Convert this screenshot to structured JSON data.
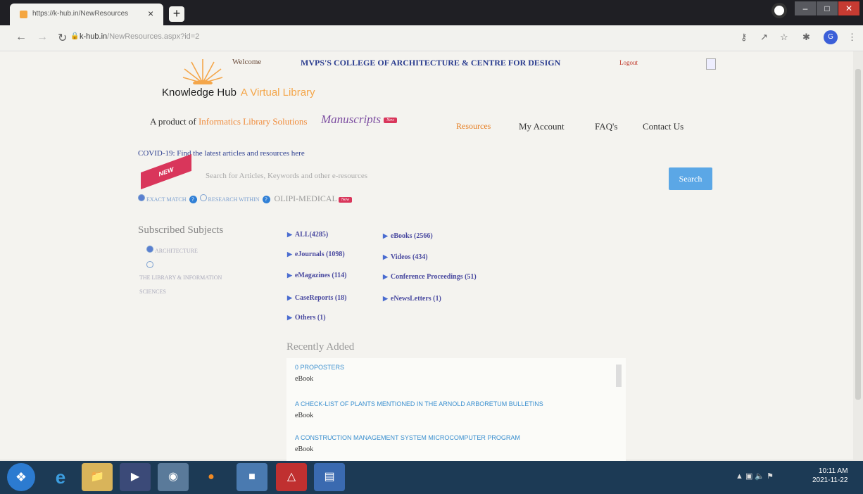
{
  "browser": {
    "tab_title": "https://k-hub.in/NewResources",
    "tab_close": "×",
    "new_tab": "+",
    "url_host": "k-hub.in",
    "url_path": "/NewResources.aspx?id=2",
    "avatar": "G"
  },
  "header": {
    "welcome": "Welcome",
    "college": "MVPS'S COLLEGE OF ARCHITECTURE & CENTRE FOR DESIGN",
    "logout": "Logout",
    "brand": "Knowledge Hub",
    "brand_sub": "A Virtual Library",
    "product_prefix": "A product of",
    "product_name": "Informatics Library Solutions",
    "manuscripts": "Manuscripts",
    "new_badge": "New"
  },
  "nav": {
    "resources": "Resources",
    "my_account": "My Account",
    "faq": "FAQ's",
    "contact": "Contact Us"
  },
  "covid": "COVID-19: Find the latest articles and resources here",
  "search": {
    "ribbon": "NEW",
    "placeholder": "Search for Articles, Keywords and other e-resources",
    "button": "Search",
    "opt_exact": "EXACT MATCH",
    "opt_research": "RESEARCH WITHIN",
    "olipi": "OLIPI-MEDICAL",
    "help": "?"
  },
  "subjects": {
    "title": "Subscribed Subjects",
    "items": [
      "ARCHITECTURE",
      "THE LIBRARY & INFORMATION",
      "SCIENCES"
    ]
  },
  "categories": [
    {
      "label": "ALL(4285)"
    },
    {
      "label": "eBooks (2566)"
    },
    {
      "label": "eJournals (1098)"
    },
    {
      "label": "Videos (434)"
    },
    {
      "label": "eMagazines (114)"
    },
    {
      "label": "Conference Proceedings (51)"
    },
    {
      "label": "CaseReports (18)"
    },
    {
      "label": "eNewsLetters (1)"
    },
    {
      "label": "Others (1)"
    }
  ],
  "recent": {
    "title": "Recently Added",
    "items": [
      {
        "title": "0 PROPOSTERS",
        "kind": "eBook"
      },
      {
        "title": "A CHECK-LIST OF PLANTS MENTIONED IN THE ARNOLD ARBORETUM BULLETINS",
        "kind": "eBook"
      },
      {
        "title": "A CONSTRUCTION MANAGEMENT SYSTEM MICROCOMPUTER PROGRAM",
        "kind": "eBook"
      }
    ]
  },
  "taskbar": {
    "time": "10:11 AM",
    "date": "2021-11-22"
  }
}
